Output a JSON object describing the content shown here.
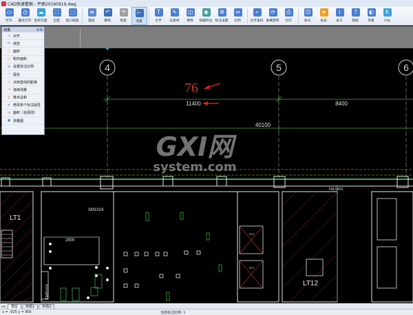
{
  "window": {
    "title": "CAD快速看图 - 平面20160919.dwg"
  },
  "toolbar": {
    "items": [
      {
        "label": "打开",
        "icon": "folder-icon",
        "color": "#4a7fd0"
      },
      {
        "label": "最近打开",
        "icon": "clock-icon",
        "color": "#4a7fd0"
      },
      {
        "label": "坐标云盘",
        "icon": "cloud-icon",
        "color": "#3aa0e0"
      },
      {
        "label": "全图",
        "icon": "fullview-icon",
        "color": "#4a7fd0"
      },
      {
        "label": "窗口缩放",
        "icon": "window-zoom-icon",
        "color": "#4a7fd0"
      },
      {
        "label": "图层",
        "icon": "layers-icon",
        "color": "#5a8ad0"
      },
      {
        "label": "撤销",
        "icon": "undo-icon",
        "color": "#3c6fb8"
      },
      {
        "label": "恢复",
        "icon": "redo-icon",
        "color": "#a0a0a0"
      },
      {
        "label": "测量",
        "icon": "measure-icon",
        "color": "#3c6fb8"
      },
      {
        "label": "文字",
        "icon": "text-icon",
        "color": "#4a7fd0"
      },
      {
        "label": "任意线",
        "icon": "freeline-icon",
        "color": "#4a7fd0"
      },
      {
        "label": "擦除",
        "icon": "eraser-icon",
        "color": "#4a7fd0"
      },
      {
        "label": "隐藏标注",
        "icon": "hide-annotation-icon",
        "color": "#3aa0a0"
      },
      {
        "label": "标注设置",
        "icon": "annotation-settings-icon",
        "color": "#4a7fd0"
      },
      {
        "label": "比例",
        "icon": "scale-icon",
        "color": "#4a7fd0"
      },
      {
        "label": "文字查找",
        "icon": "text-search-icon",
        "color": "#4a7fd0"
      },
      {
        "label": "屏幕旋转",
        "icon": "rotate-icon",
        "color": "#4a7fd0"
      },
      {
        "label": "打印",
        "icon": "print-icon",
        "color": "#4a7fd0"
      },
      {
        "label": "账号",
        "icon": "account-icon",
        "color": "#4a7fd0"
      },
      {
        "label": "会员",
        "icon": "vip-icon",
        "color": "#f0a020"
      },
      {
        "label": "关于",
        "icon": "about-icon",
        "color": "#4a7fd0"
      },
      {
        "label": "帮助",
        "icon": "help-icon",
        "color": "#4a7fd0"
      },
      {
        "label": "风格",
        "icon": "style-icon",
        "color": "#4a7fd0"
      },
      {
        "label": "小站",
        "icon": "k-site-icon",
        "color": "#3aa0e0"
      }
    ]
  },
  "measure_panel": {
    "title": "测量",
    "items": [
      {
        "label": "对齐",
        "icon": "align-measure-icon"
      },
      {
        "label": "线性",
        "icon": "linear-measure-icon"
      },
      {
        "label": "面积",
        "icon": "area-icon"
      },
      {
        "label": "矩形面积",
        "icon": "rect-area-icon"
      },
      {
        "label": "设置标注比例",
        "icon": "set-scale-icon"
      },
      {
        "label": "弧长",
        "icon": "arc-length-icon"
      },
      {
        "label": "点到直线的距离",
        "icon": "point-line-icon"
      },
      {
        "label": "连续测量",
        "icon": "continuous-measure-icon"
      },
      {
        "label": "算术总和",
        "icon": "sum-icon"
      },
      {
        "label": "修改单个标注属性",
        "icon": "edit-annotation-icon"
      },
      {
        "label": "面积（含弧线）",
        "icon": "area-arc-icon"
      },
      {
        "label": "测量图",
        "icon": "measure-drawing-icon"
      }
    ]
  },
  "drawing": {
    "axis_labels": [
      "4",
      "5",
      "6"
    ],
    "measured_value": "76",
    "dim_11400": "11400",
    "dim_8400": "8400",
    "dim_40100": "40100",
    "door_sm1024": "SM1024",
    "door_fmj1021": "FMJ1021",
    "room_lt1": "LT1",
    "room_lt12": "LT12",
    "dim_2800": "2800",
    "fm_label": "FMB1018",
    "elevator_1": "DT1",
    "elevator_2": "DT1"
  },
  "watermark": {
    "line1": "GXI网",
    "line2": "system.com"
  },
  "tabs": {
    "items": [
      "模型",
      "布局1",
      "布局2"
    ]
  },
  "statusbar": {
    "coords": "x = -925  y = 80k",
    "ratio": "当前标注比例: 1"
  },
  "colors": {
    "annotation_red": "#c83a3a",
    "dimension_green": "#3fa84a",
    "wall_white": "#e8e8e8",
    "cyan_marker": "#00c8e0",
    "yellow_grid": "#d8c020"
  }
}
